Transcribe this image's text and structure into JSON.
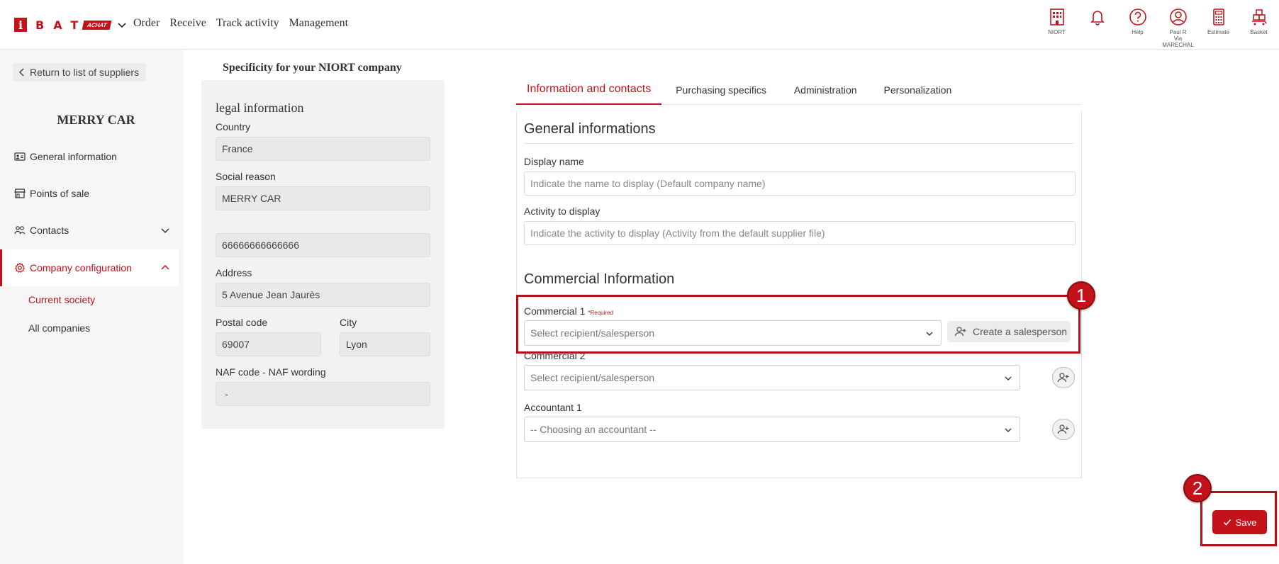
{
  "brand": {
    "letters": "BAT",
    "i": "i",
    "achat": "ACHAT",
    "accent": "#c4121a"
  },
  "topnav": {
    "items": [
      "Order",
      "Receive",
      "Track activity",
      "Management"
    ]
  },
  "topicons": [
    {
      "icon": "building-icon",
      "label": "NIORT"
    },
    {
      "icon": "bell-icon",
      "label": ""
    },
    {
      "icon": "help-icon",
      "label": "Help"
    },
    {
      "icon": "user-icon",
      "label": "Paul R",
      "sublabel": "Via MARECHAL"
    },
    {
      "icon": "calculator-icon",
      "label": "Estimate"
    },
    {
      "icon": "basket-icon",
      "label": "Basket"
    }
  ],
  "sidebar": {
    "return_label": "Return to list of suppliers",
    "supplier_name": "MERRY CAR",
    "items": [
      {
        "icon": "id-card-icon",
        "label": "General information"
      },
      {
        "icon": "store-icon",
        "label": "Points of sale"
      },
      {
        "icon": "users-icon",
        "label": "Contacts"
      },
      {
        "icon": "gear-icon",
        "label": "Company configuration"
      }
    ],
    "subitems": [
      "Current society",
      "All companies"
    ]
  },
  "main": {
    "spec_title": "Specificity for your NIORT company",
    "legal": {
      "title": "legal information",
      "country_label": "Country",
      "country": "France",
      "social_reason_label": "Social reason",
      "social_reason": "MERRY CAR",
      "siret": "66666666666666",
      "address_label": "Address",
      "address": "5 Avenue Jean Jaurès",
      "postal_label": "Postal code",
      "postal": "69007",
      "city_label": "City",
      "city": "Lyon",
      "naf_label": "NAF code - NAF wording",
      "naf": "-"
    },
    "tabs": [
      "Information and contacts",
      "Purchasing specifics",
      "Administration",
      "Personalization"
    ],
    "general": {
      "title": "General informations",
      "display_name_label": "Display name",
      "display_name_placeholder": "Indicate the name to display (Default company name)",
      "activity_label": "Activity to display",
      "activity_placeholder": "Indicate the activity to display (Activity from the default supplier file)"
    },
    "commercial": {
      "title": "Commercial Information",
      "c1_label": "Commercial 1",
      "required": "*Required",
      "c1_placeholder": "Select recipient/salesperson",
      "create_label": "Create a salesperson",
      "c2_label": "Commercial 2",
      "c2_placeholder": "Select recipient/salesperson",
      "acc_label": "Accountant 1",
      "acc_placeholder": "-- Choosing an accountant --"
    },
    "save_label": "Save"
  },
  "annotations": {
    "badge1": "1",
    "badge2": "2"
  }
}
